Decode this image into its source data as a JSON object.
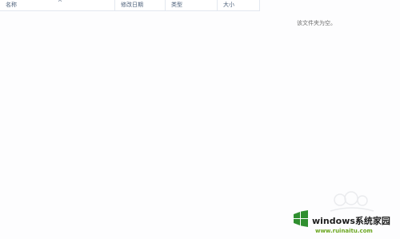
{
  "columns": {
    "name": "名称",
    "date_modified": "修改日期",
    "type": "类型",
    "size": "大小"
  },
  "list": {
    "empty_message": "该文件夹为空。"
  },
  "watermark": {
    "brand": "windows系统家园",
    "url": "www.ruinaitu.com"
  },
  "colors": {
    "header_text": "#4c607a",
    "header_border": "#e3e8f0",
    "empty_text": "#6d6d6d",
    "watermark_green": "#6aa61f"
  },
  "icons": {
    "sort": "sort-caret-icon",
    "logo": "windows-logo-icon"
  }
}
